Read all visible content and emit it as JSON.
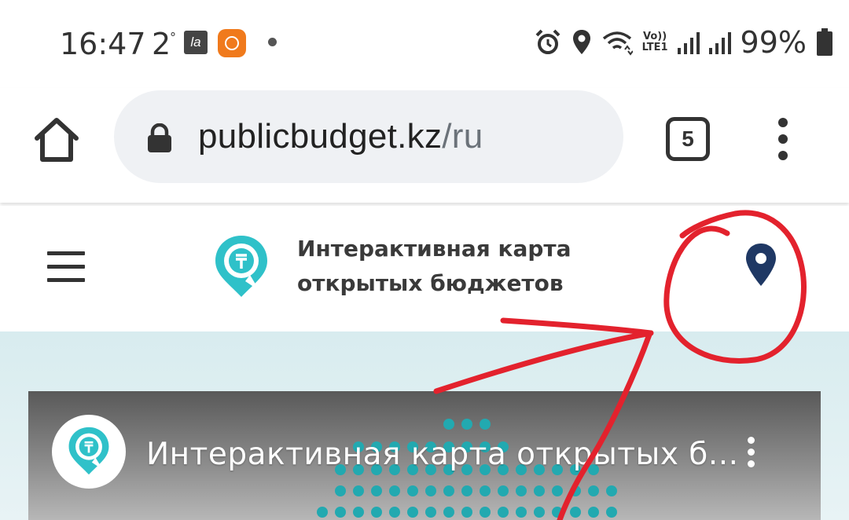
{
  "status_bar": {
    "time": "16:47",
    "temperature": "2",
    "degree_symbol": "°",
    "app_icon_la": "la",
    "battery_percent": "99%",
    "network_label_top": "Vo))",
    "network_label_bottom": "LTE1"
  },
  "browser": {
    "url_host": "publicbudget.kz",
    "url_path": "/ru",
    "tab_count": "5"
  },
  "site": {
    "title_line1": "Интерактивная карта",
    "title_line2": "открытых бюджетов",
    "accent_color": "#2fc1c9",
    "pin_color": "#1f3864"
  },
  "video": {
    "title": "Интерактивная карта открытых б..."
  },
  "annotation": {
    "color": "#e3222d"
  }
}
